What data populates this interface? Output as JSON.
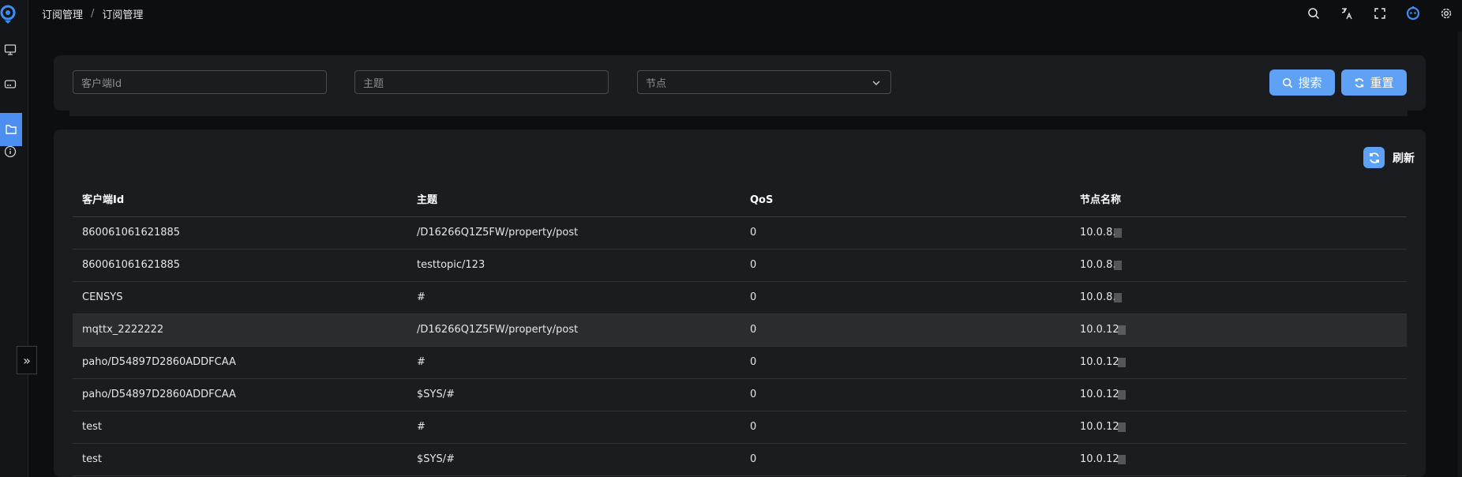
{
  "breadcrumb": {
    "parent": "订阅管理",
    "separator": "/",
    "current": "订阅管理"
  },
  "colors": {
    "accent": "#5fa2f5",
    "sidebar_active": "#4c8ff0"
  },
  "sidebar": {
    "items": [
      {
        "icon": "monitor-icon"
      },
      {
        "icon": "router-icon"
      },
      {
        "icon": "folder-icon",
        "active": true
      },
      {
        "icon": "info-icon"
      }
    ],
    "collapse_glyph": "»"
  },
  "header_icons": [
    "search-icon",
    "translate-icon",
    "fullscreen-icon",
    "robot-logo-icon",
    "gear-icon"
  ],
  "filter": {
    "client_id": {
      "placeholder": "客户端Id",
      "value": ""
    },
    "topic": {
      "placeholder": "主题",
      "value": ""
    },
    "node": {
      "placeholder": "节点",
      "value": ""
    },
    "search_label": "搜索",
    "reset_label": "重置"
  },
  "table": {
    "refresh_label": "刷新",
    "columns": [
      "客户端Id",
      "主题",
      "QoS",
      "节点名称"
    ],
    "rows": [
      {
        "client_id": "860061061621885",
        "topic": "/D16266Q1Z5FW/property/post",
        "qos": "0",
        "node": "10.0.8."
      },
      {
        "client_id": "860061061621885",
        "topic": "testtopic/123",
        "qos": "0",
        "node": "10.0.8."
      },
      {
        "client_id": "CENSYS",
        "topic": "#",
        "qos": "0",
        "node": "10.0.8."
      },
      {
        "client_id": "mqttx_2222222",
        "topic": "/D16266Q1Z5FW/property/post",
        "qos": "0",
        "node": "10.0.12"
      },
      {
        "client_id": "paho/D54897D2860ADDFCAA",
        "topic": "#",
        "qos": "0",
        "node": "10.0.12"
      },
      {
        "client_id": "paho/D54897D2860ADDFCAA",
        "topic": "$SYS/#",
        "qos": "0",
        "node": "10.0.12"
      },
      {
        "client_id": "test",
        "topic": "#",
        "qos": "0",
        "node": "10.0.12"
      },
      {
        "client_id": "test",
        "topic": "$SYS/#",
        "qos": "0",
        "node": "10.0.12"
      }
    ]
  }
}
